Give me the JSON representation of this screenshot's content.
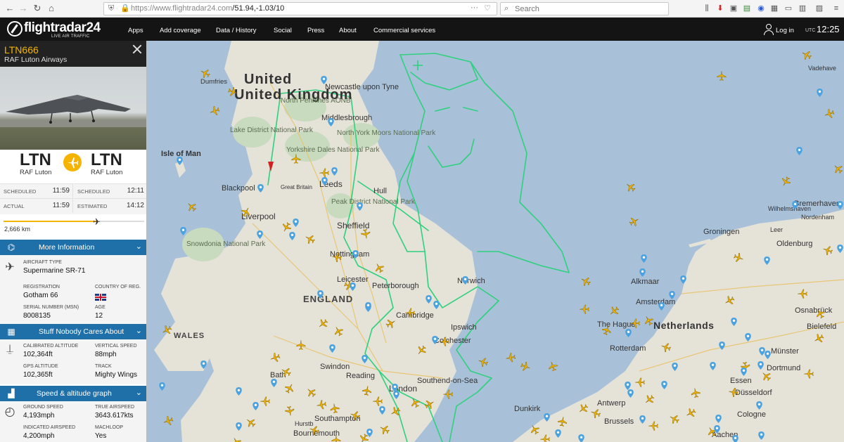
{
  "browser": {
    "url_host": "https://www.flightradar24.com",
    "url_path": "/51.94,-1.03/10",
    "search_placeholder": "Search",
    "back_icon": "back-arrow-icon",
    "forward_icon": "forward-arrow-icon",
    "reload_icon": "reload-icon",
    "home_icon": "home-icon"
  },
  "header": {
    "logo_text": "flightradar24",
    "logo_sub": "LIVE AIR TRAFFIC",
    "nav": [
      "Apps",
      "Add coverage",
      "Data / History",
      "Social",
      "Press",
      "About",
      "Commercial services"
    ],
    "login": "Log in",
    "utc_label": "UTC",
    "time": "12:25"
  },
  "flight": {
    "callsign": "LTN666",
    "airline": "RAF Luton Airways",
    "origin_code": "LTN",
    "origin_name": "RAF Luton",
    "dest_code": "LTN",
    "dest_name": "RAF Luton",
    "times": {
      "scheduled_dep_label": "SCHEDULED",
      "scheduled_dep": "11:59",
      "scheduled_arr_label": "SCHEDULED",
      "scheduled_arr": "12:11",
      "actual_dep_label": "ACTUAL",
      "actual_dep": "11:59",
      "estimated_arr_label": "ESTIMATED",
      "estimated_arr": "14:12"
    },
    "progress_fraction": 0.66,
    "distance": "2,666 km"
  },
  "more_info": {
    "title": "More Information",
    "aircraft_type_label": "AIRCRAFT TYPE",
    "aircraft_type": "Supermarine SR-71",
    "registration_label": "REGISTRATION",
    "registration": "Gotham 66",
    "country_label": "COUNTRY OF REG.",
    "serial_label": "SERIAL NUMBER (MSN)",
    "serial": "8008135",
    "age_label": "AGE",
    "age": "12"
  },
  "stuff": {
    "title": "Stuff Nobody Cares About",
    "cal_alt_label": "CALIBRATED ALTITUDE",
    "cal_alt": "102,364ft",
    "vspeed_label": "VERTICAL SPEED",
    "vspeed": "88mph",
    "gps_alt_label": "GPS ALTITUDE",
    "gps_alt": "102,365ft",
    "track_label": "TRACK",
    "track": "Mighty Wings"
  },
  "speed": {
    "title": "Speed & altitude graph",
    "ground_label": "GROUND SPEED",
    "ground": "4,193mph",
    "true_label": "TRUE AIRSPEED",
    "true": "3643.617kts",
    "indicated_label": "INDICATED AIRSPEED",
    "indicated": "4,200mph",
    "machloop_label": "MACHLOOP",
    "machloop": "Yes"
  },
  "map": {
    "country_uk": "United Kingdom",
    "isle_of_man": "Isle of Man",
    "england": "ENGLAND",
    "wales": "WALES",
    "netherlands": "Netherlands",
    "cities": [
      "Newcastle upon Tyne",
      "Dumfries",
      "Middlesbrough",
      "Blackpool",
      "Leeds",
      "Hull",
      "Liverpool",
      "Sheffield",
      "Nottingham",
      "Leicester",
      "Peterborough",
      "Norwich",
      "Cambridge",
      "Ipswich",
      "Colchester",
      "Swindon",
      "Reading",
      "London",
      "Southend-on-Sea",
      "Bath",
      "Southampton",
      "Bournemouth",
      "Groningen",
      "Oldenburg",
      "Bremerhaven",
      "Wilhelmshaven",
      "Leer",
      "Alkmaar",
      "Amsterdam",
      "The Hague",
      "Rotterdam",
      "Antwerp",
      "Brussels",
      "Osnabrück",
      "Bielefeld",
      "Münster",
      "Dortmund",
      "Essen",
      "Düsseldorf",
      "Cologne",
      "Aachen",
      "Nordenham",
      "Vadehave",
      "Dunkirk",
      "Great Britain",
      "Lake District National Park",
      "North Pennines AONB",
      "Yorkshire Dales National Park",
      "North York Moors National Park",
      "Peak District National Park",
      "Snowdonia National Park",
      "Hurstb"
    ],
    "colors": {
      "land": "#e8e4da",
      "sea": "#a8c1d9",
      "accent": "#f5b400",
      "track": "#2fd07e",
      "brand_blue": "#1f6fa8"
    }
  }
}
